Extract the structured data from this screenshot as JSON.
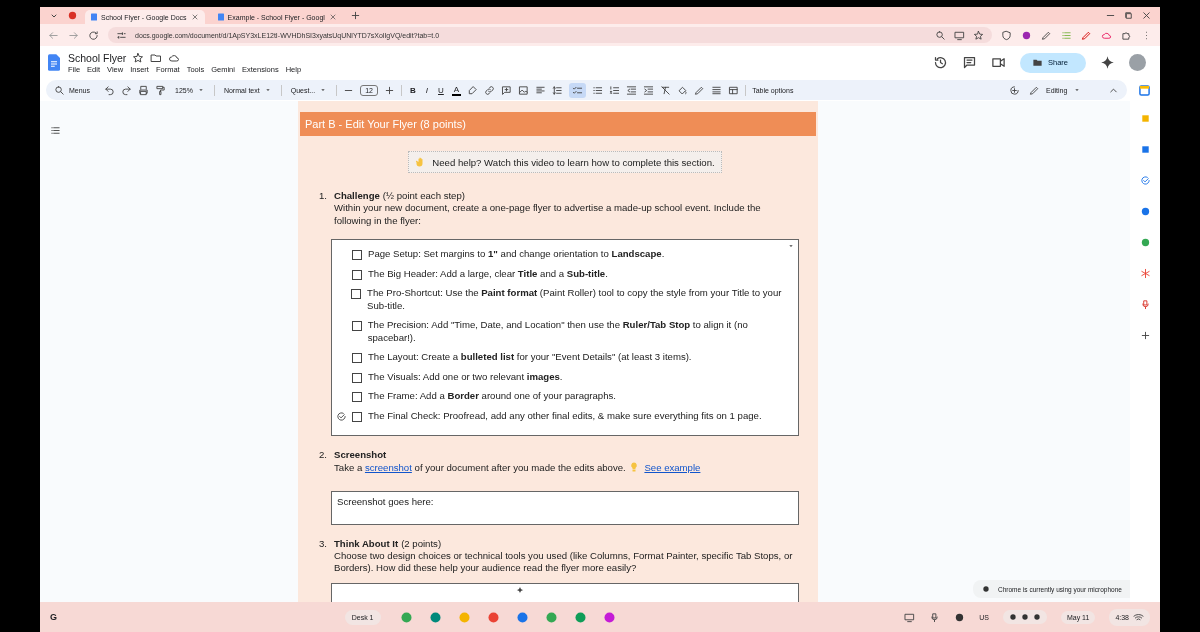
{
  "browser": {
    "tabs": [
      {
        "title": "School Flyer - Google Docs",
        "selected": true
      },
      {
        "title": "Example - School Flyer - Googl",
        "selected": false
      }
    ],
    "url": "docs.google.com/document/d/1ApSY3xLE12tI-WVHDhSI3xyatsUqUNlYTD7sXolIgVQ/edit?tab=t.0"
  },
  "docs": {
    "title": "School Flyer",
    "menus": [
      "File",
      "Edit",
      "View",
      "Insert",
      "Format",
      "Tools",
      "Gemini",
      "Extensions",
      "Help"
    ],
    "share_label": "Share"
  },
  "toolbar": {
    "search_label": "Menus",
    "zoom": "125%",
    "style": "Normal text",
    "font": "Quest...",
    "font_size": "12",
    "format_buttons": [
      "B",
      "I",
      "U",
      "A"
    ],
    "checklist_active": true,
    "table_options": "Table options",
    "mode": "Editing"
  },
  "document": {
    "section_header": "Part B - Edit Your Flyer (8 points)",
    "help_banner": "Need help? Watch this video to learn how to complete this section.",
    "sections": [
      {
        "number": "1.",
        "title": "Challenge",
        "note": "(½ point each step)",
        "body": [
          {
            "kind": "text",
            "text": "Within your new document, create a one-page flyer to advertise a made-up school event. Include the following in the flyer:"
          }
        ],
        "checklist": [
          {
            "text": "Page Setup: Set margins to **1\"** and change orientation to **Landscape**.",
            "checked": false,
            "assign_icon": false
          },
          {
            "text": "The Big Header: Add a large, clear **Title** and a **Sub-title**.",
            "checked": false,
            "assign_icon": false
          },
          {
            "text": "The Pro-Shortcut: Use the **Paint format** (Paint Roller) tool to copy the style from your Title to your Sub-title.",
            "checked": false,
            "assign_icon": false
          },
          {
            "text": "The Precision: Add \"Time, Date, and Location\" then use the **Ruler/Tab Stop** to align it (no spacebar!).",
            "checked": false,
            "assign_icon": false
          },
          {
            "text": "The Layout: Create a **bulleted list** for your \"Event Details\" (at least 3 items).",
            "checked": false,
            "assign_icon": false
          },
          {
            "text": "The Visuals: Add one or two relevant **images**.",
            "checked": false,
            "assign_icon": false
          },
          {
            "text": "The Frame: Add a **Border** around one of your paragraphs.",
            "checked": false,
            "assign_icon": false
          },
          {
            "text": "The Final Check: Proofread, add any other final edits, & make sure everything fits on 1 page.",
            "checked": false,
            "assign_icon": true
          }
        ]
      },
      {
        "number": "2.",
        "title": "Screenshot",
        "body": [
          {
            "kind": "text",
            "text": "Take a "
          },
          {
            "kind": "link",
            "text": "screenshot"
          },
          {
            "kind": "text",
            "text": " of your document after you made the edits above. "
          },
          {
            "kind": "bulb"
          },
          {
            "kind": "link",
            "text": "See example"
          }
        ],
        "answer_box": "Screenshot goes here:"
      },
      {
        "number": "3.",
        "title": "Think About It",
        "note": "(2 points)",
        "body": [
          {
            "kind": "text",
            "text": "Choose two design choices or technical tools you used (like Columns, Format Painter, specific Tab Stops, or Borders). How did these help your audience read the flyer more easily?"
          }
        ],
        "answer_box_shown": true
      }
    ]
  },
  "notification": "Chrome is currently using your microphone",
  "taskbar": {
    "launcher": "G",
    "desk": "Desk 1",
    "input_lang": "US",
    "date": "May 11",
    "time": "4:38"
  }
}
